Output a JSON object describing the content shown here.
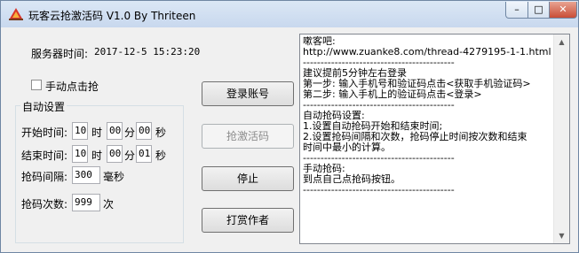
{
  "window": {
    "title": "玩客云抢激活码 V1.0   By Thriteen",
    "minimize_glyph": "–",
    "maximize_glyph": "□",
    "close_glyph": "✕"
  },
  "server_time": {
    "label": "服务器时间:",
    "value": "2017-12-5 15:23:20"
  },
  "manual_grab": {
    "label": "手动点击抢",
    "checked": false
  },
  "auto_settings": {
    "group_title": "自动设置",
    "start_label": "开始时间:",
    "start_hour": "10",
    "start_min": "00",
    "start_sec": "00",
    "end_label": "结束时间:",
    "end_hour": "10",
    "end_min": "00",
    "end_sec": "01",
    "unit_hour": "时",
    "unit_min": "分",
    "unit_sec": "秒",
    "interval_label": "抢码间隔:",
    "interval_value": "300",
    "interval_unit": "毫秒",
    "count_label": "抢码次数:",
    "count_value": "999",
    "count_unit": "次"
  },
  "buttons": {
    "login": "登录账号",
    "grab": "抢激活码",
    "stop": "停止",
    "tip": "打赏作者"
  },
  "log": {
    "text": "嗽客吧:\nhttp://www.zuanke8.com/thread-4279195-1-1.html\n-------------------------------------------\n建议提前5分钟左右登录\n第一步: 输入手机号和验证码点击<获取手机验证码>\n第二步: 输入手机上的验证码点击<登录>\n-------------------------------------------\n自动抢码设置:\n1.设置自动抢码开始和结束时间;\n2.设置抢码间隔和次数，抢码停止时间按次数和结束\n时间中最小的计算。\n-------------------------------------------\n手动抢码:\n到点自己点抢码按钮。\n-------------------------------------------"
  }
}
